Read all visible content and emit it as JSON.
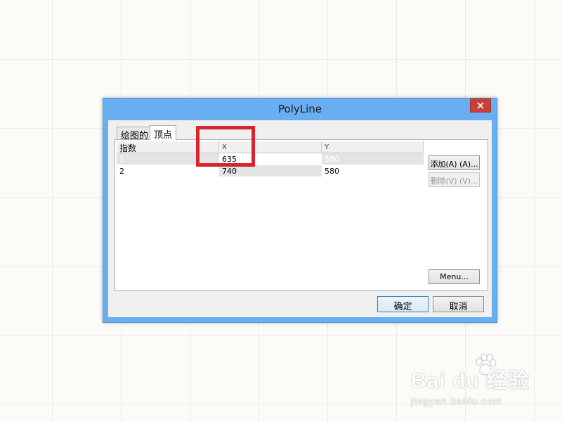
{
  "dialog": {
    "title": "PolyLine",
    "close_icon": "close-icon"
  },
  "tabs": [
    {
      "label": "绘图的"
    },
    {
      "label": "顶点"
    }
  ],
  "grid": {
    "columns": [
      "指数",
      "X",
      "Y"
    ],
    "rows": [
      {
        "index": "1",
        "x": "635",
        "y": "580"
      },
      {
        "index": "2",
        "x": "740",
        "y": "580"
      }
    ]
  },
  "buttons": {
    "add": "添加(A) (A)...",
    "delete": "删除(V) (V)...",
    "menu": "Menu...",
    "ok": "确定",
    "cancel": "取消"
  },
  "watermark": {
    "brand": "Bai du 经验",
    "url": "jingyan.baidu.com"
  },
  "colors": {
    "title_bar": "#68aef1",
    "close_button": "#c7413a",
    "highlight": "#d9232e"
  }
}
